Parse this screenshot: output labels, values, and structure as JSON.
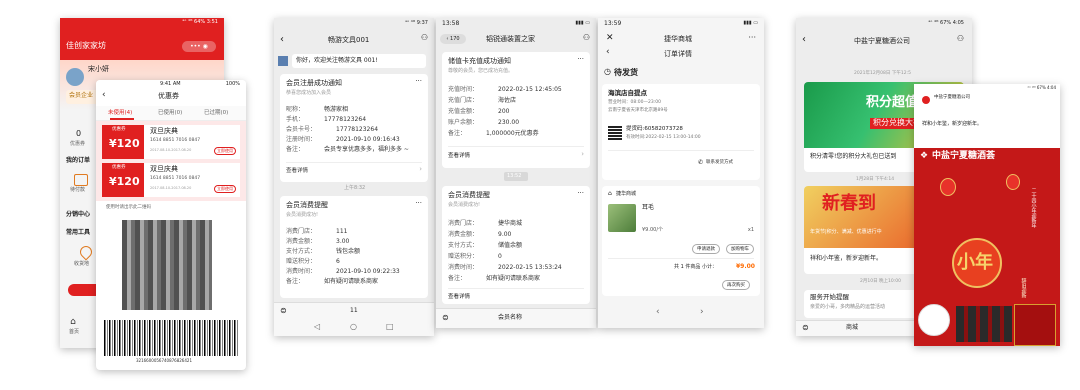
{
  "colors": {
    "red": "#e02020",
    "green": "#07c160",
    "orange": "#ff6a00",
    "bg": "#f4f4f4"
  },
  "s1": {
    "status": "ᵃᵒ ⁴ᴳ 64% 3:51",
    "app_title": "佳创家家坊",
    "user": "宋小妍",
    "member_hint": "会员企业",
    "stat_num": "0",
    "stat_label": "优惠券",
    "my_orders": "我的订单",
    "pending": "待付款",
    "share_center": "分销中心",
    "tools": "常用工具",
    "addr": "收货地",
    "home_tab": "首页",
    "ov_time": "9:41 AM",
    "ov_batt": "100%",
    "ov_title": "优惠券",
    "tabs": [
      "未使用(4)",
      "已使用(0)",
      "已过期(0)"
    ],
    "coupons": [
      {
        "tag": "优惠券",
        "amount": "¥120",
        "name": "双旦庆典",
        "code": "1614 8851 7016 0847",
        "date": "2017.08.10-2017.08.20",
        "btn": "立即使用"
      },
      {
        "tag": "优惠券",
        "amount": "¥120",
        "name": "双旦庆典",
        "code": "1614 8851 7016 0847",
        "date": "2017.08.10-2017.08.20",
        "btn": "立即使用"
      }
    ],
    "qr_tip": "使用时请出示此二维码",
    "barcode_num": "3216600056740876826421"
  },
  "s2": {
    "status": "ᵃᵒ ⁴ᴳ 9:37",
    "title": "畅游文具001",
    "welcome": "你好，欢迎关注畅游文具 001!",
    "card1": {
      "title": "会员注册成功通知",
      "sub": "恭喜您成功加入会员",
      "rows": [
        {
          "k": "昵称：",
          "v": "畅游家相"
        },
        {
          "k": "手机：",
          "v": "17778123264"
        },
        {
          "k": "会员卡号：",
          "v": "17778123264"
        },
        {
          "k": "注册时间：",
          "v": "2021-09-10 09:16:43"
        },
        {
          "k": "备注：",
          "v": "会员专享优惠多多，福利多多 ~"
        }
      ],
      "link": "查看详情"
    },
    "divider": "上午8:32",
    "card2": {
      "title": "会员消费提醒",
      "sub": "会员消费成功!",
      "rows": [
        {
          "k": "消费门店：",
          "v": "111"
        },
        {
          "k": "消费金额：",
          "v": "3.00"
        },
        {
          "k": "支付方式：",
          "v": "钱包余额"
        },
        {
          "k": "赠送积分：",
          "v": "6"
        },
        {
          "k": "消费时间：",
          "v": "2021-09-10 09:22:33"
        },
        {
          "k": "备注：",
          "v": "如有疑问请联系商家"
        }
      ]
    },
    "page_num": "11"
  },
  "s3": {
    "time": "13:58",
    "badge": "170",
    "title": "韬锐通装置之家",
    "card1": {
      "title": "储值卡充值成功通知",
      "sub": "尊敬的会员，您已成功充值。",
      "rows": [
        {
          "k": "充值时间：",
          "v": "2022-02-15 12:45:05"
        },
        {
          "k": "充值门店：",
          "v": "海佐店"
        },
        {
          "k": "充值金额：",
          "v": "200"
        },
        {
          "k": "账户余额：",
          "v": "230.00"
        },
        {
          "k": "备注：",
          "v": "1,000000元优惠券"
        }
      ],
      "link": "查看详情"
    },
    "divider": "13:52",
    "card2": {
      "title": "会员消费提醒",
      "sub": "会员消费成功!",
      "rows": [
        {
          "k": "消费门店：",
          "v": "捷华商城"
        },
        {
          "k": "消费金额：",
          "v": "9.00"
        },
        {
          "k": "支付方式：",
          "v": "储值余额"
        },
        {
          "k": "赠送积分：",
          "v": "0"
        },
        {
          "k": "消费时间：",
          "v": "2022-02-15 13:53:24"
        },
        {
          "k": "备注：",
          "v": "如有疑问请联系商家"
        }
      ],
      "link": "查看详情"
    },
    "bottom": "会员名称"
  },
  "s4": {
    "time": "13:59",
    "title": "捷华商城",
    "subtitle": "订单详情",
    "state": "待发货",
    "store_name": "海滨店自提点",
    "store_hours": "营业时间：08:00—23:00",
    "store_addr": "云南宁夏省天津市北京路89号",
    "pick_code": "提货码:60582073728",
    "pick_time": "有效时间:2022-02-15 13:00-14:00",
    "contact": "联系发货方式",
    "shop": "捷华商城",
    "product_name": "耳毛",
    "price": "¥9.00/个",
    "qty": "x1",
    "btn_refund": "申请退款",
    "btn_cart": "加购物车",
    "total": "共 1 件商品  小计：",
    "total_price": "¥9.00",
    "btn_again": "再次购买"
  },
  "s5": {
    "status": "ᵃᵒ ⁴ᴳ 67% 4:05",
    "title": "中盐宁夏糖酒公司",
    "date1": "2021年12月08日 下午12:5",
    "banner1": "积分超值兑",
    "banner1_sub": "积分兑换大礼",
    "caption1": "积分清零!您的积分大礼包已送到",
    "date2": "1月28日 下午4:14",
    "banner2": "新春到",
    "banner2_sub": "年货节|积分、满减、优惠进行中",
    "caption2": "祥和小年鉴，新岁迎新年。",
    "date3": "2月10日 晚上10:00",
    "msg3_title": "服务开始提醒",
    "msg3_body": "亲爱的小哥，多肉精品的运营活动",
    "bottom": "商城",
    "ov_status": "ᵃᵒ ⁴ᴳ 67% 4:04",
    "ov_sender": "中盐宁夏糖酒公司",
    "ov_msg": "祥和小年鉴，新岁迎新年。",
    "poster_title": "中盐宁夏糖酒荟",
    "poster_text": "小年",
    "poster_side": "二十四小年迎新年",
    "poster_side2": "辞旧迎新"
  }
}
